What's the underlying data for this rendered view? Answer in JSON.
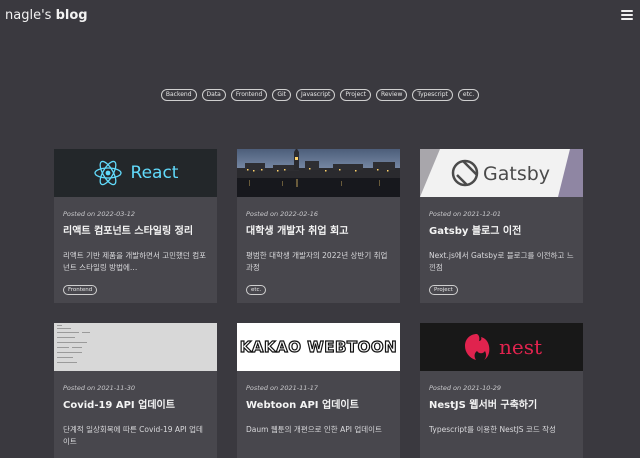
{
  "header": {
    "blog_owner": "nagle's",
    "blog_word": "blog"
  },
  "tags": [
    "Backend",
    "Data",
    "Frontend",
    "Git",
    "Javascript",
    "Project",
    "Review",
    "Typescript",
    "etc."
  ],
  "posts": [
    {
      "date": "Posted on 2022-03-12",
      "title": "리액트 컴포넌트 스타일링 정리",
      "desc": "리액트 기반 제품을 개발하면서 고민했던 컴포넌트 스타일링 방법에…",
      "tag": "Frontend",
      "thumb_text": "React"
    },
    {
      "date": "Posted on 2022-02-16",
      "title": "대학생 개발자 취업 회고",
      "desc": "평범한 대학생 개발자의 2022년 상반기 취업과정",
      "tag": "etc.",
      "thumb_text": ""
    },
    {
      "date": "Posted on 2021-12-01",
      "title": "Gatsby 블로그 이전",
      "desc": "Next.js에서 Gatsby로 블로그를 이전하고 느낀점",
      "tag": "Project",
      "thumb_text": "Gatsby"
    },
    {
      "date": "Posted on 2021-11-30",
      "title": "Covid-19 API 업데이트",
      "desc": "단계적 일상회복에 따른 Covid-19 API 업데이트",
      "tag": "",
      "thumb_text": ""
    },
    {
      "date": "Posted on 2021-11-17",
      "title": "Webtoon API 업데이트",
      "desc": "Daum 웹툰의 개편으로 인한 API 업데이트",
      "tag": "",
      "thumb_text": "KAKAO WEBTOON"
    },
    {
      "date": "Posted on 2021-10-29",
      "title": "NestJS 웹서버 구축하기",
      "desc": "Typescript를 이용한 NestJS 코드 작성",
      "tag": "",
      "thumb_text": "nest"
    }
  ],
  "colors": {
    "background": "#3a393f",
    "card": "#48474d",
    "react": "#61dafb",
    "gatsby": "#663399",
    "nest": "#e0234e"
  },
  "icons": [
    "menu-icon",
    "react-logo-icon",
    "gatsby-logo-icon",
    "nest-logo-icon"
  ]
}
